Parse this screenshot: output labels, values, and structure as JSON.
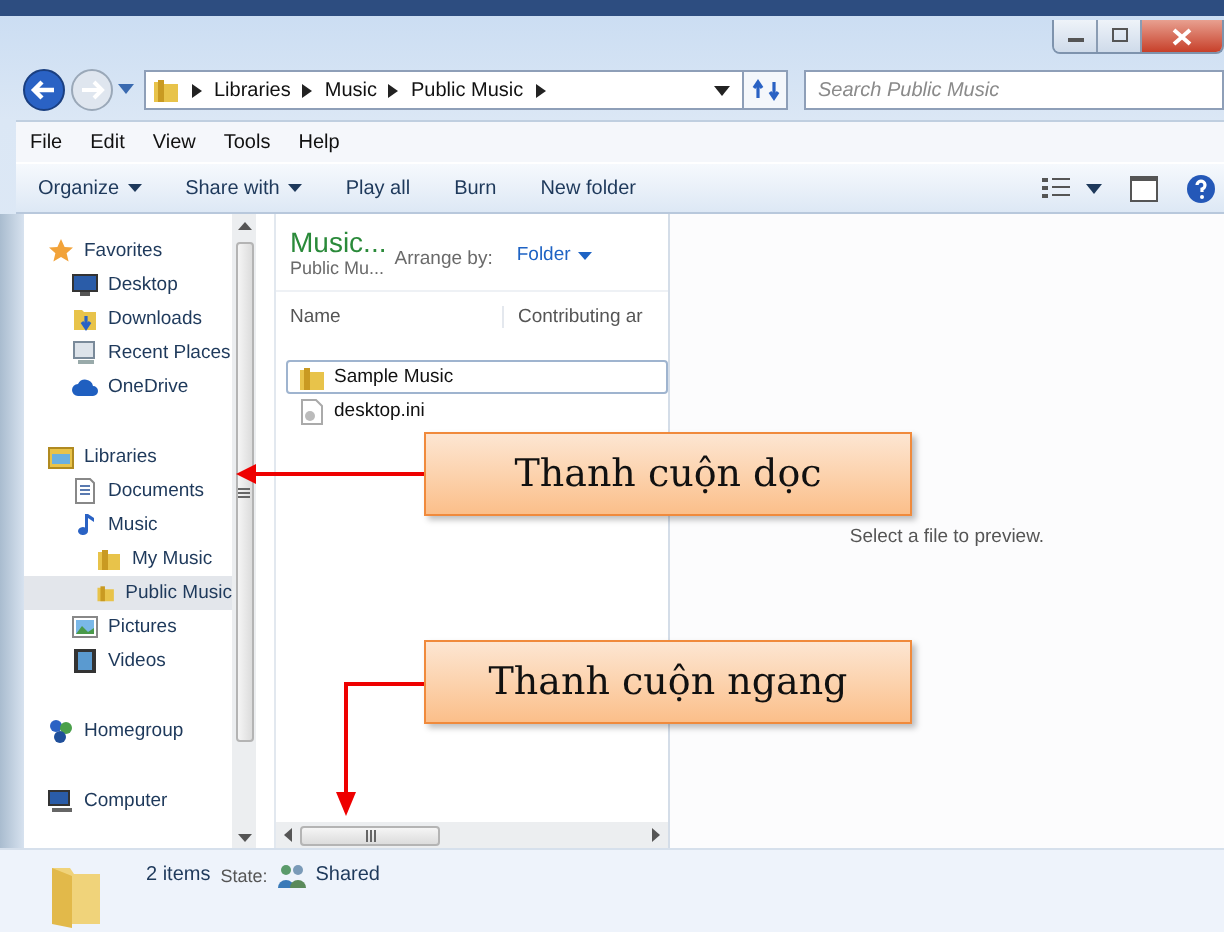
{
  "address": {
    "breadcrumb": [
      "Libraries",
      "Music",
      "Public Music"
    ]
  },
  "search": {
    "placeholder": "Search Public Music"
  },
  "menu": [
    "File",
    "Edit",
    "View",
    "Tools",
    "Help"
  ],
  "toolbar": [
    {
      "label": "Organize",
      "dropdown": true
    },
    {
      "label": "Share with",
      "dropdown": true
    },
    {
      "label": "Play all",
      "dropdown": false
    },
    {
      "label": "Burn",
      "dropdown": false
    },
    {
      "label": "New folder",
      "dropdown": false
    }
  ],
  "nav": [
    {
      "label": "Favorites",
      "kind": "star",
      "selected": false,
      "children": [
        {
          "label": "Desktop",
          "kind": "desktop",
          "selected": false
        },
        {
          "label": "Downloads",
          "kind": "downloads",
          "selected": false
        },
        {
          "label": "Recent Places",
          "kind": "recent",
          "selected": false
        },
        {
          "label": "OneDrive",
          "kind": "cloud",
          "selected": false
        }
      ]
    },
    {
      "label": "Libraries",
      "kind": "library",
      "selected": false,
      "children": [
        {
          "label": "Documents",
          "kind": "document",
          "selected": false
        },
        {
          "label": "Music",
          "kind": "music",
          "selected": false,
          "children": [
            {
              "label": "My Music",
              "kind": "folder",
              "selected": false
            },
            {
              "label": "Public Music",
              "kind": "folder",
              "selected": true
            }
          ]
        },
        {
          "label": "Pictures",
          "kind": "pictures",
          "selected": false
        },
        {
          "label": "Videos",
          "kind": "videos",
          "selected": false
        }
      ]
    },
    {
      "label": "Homegroup",
      "kind": "homegroup",
      "selected": false
    },
    {
      "label": "Computer",
      "kind": "computer",
      "selected": false
    }
  ],
  "library": {
    "title": "Music...",
    "subtitle": "Public Mu...",
    "arrange_label": "Arrange by:",
    "arrange_value": "Folder"
  },
  "columns": [
    "Name",
    "Contributing ar"
  ],
  "files": [
    {
      "name": "Sample Music",
      "kind": "folder",
      "selected": true
    },
    {
      "name": "desktop.ini",
      "kind": "settings",
      "selected": false
    }
  ],
  "preview": {
    "message": "Select a file to preview."
  },
  "status_bar": {
    "count": "2 items",
    "state_label": "State:",
    "state_value": "Shared"
  },
  "callouts": [
    {
      "text": "Thanh cuộn dọc",
      "kind": "vertical"
    },
    {
      "text": "Thanh cuộn ngang",
      "kind": "horizontal"
    }
  ]
}
